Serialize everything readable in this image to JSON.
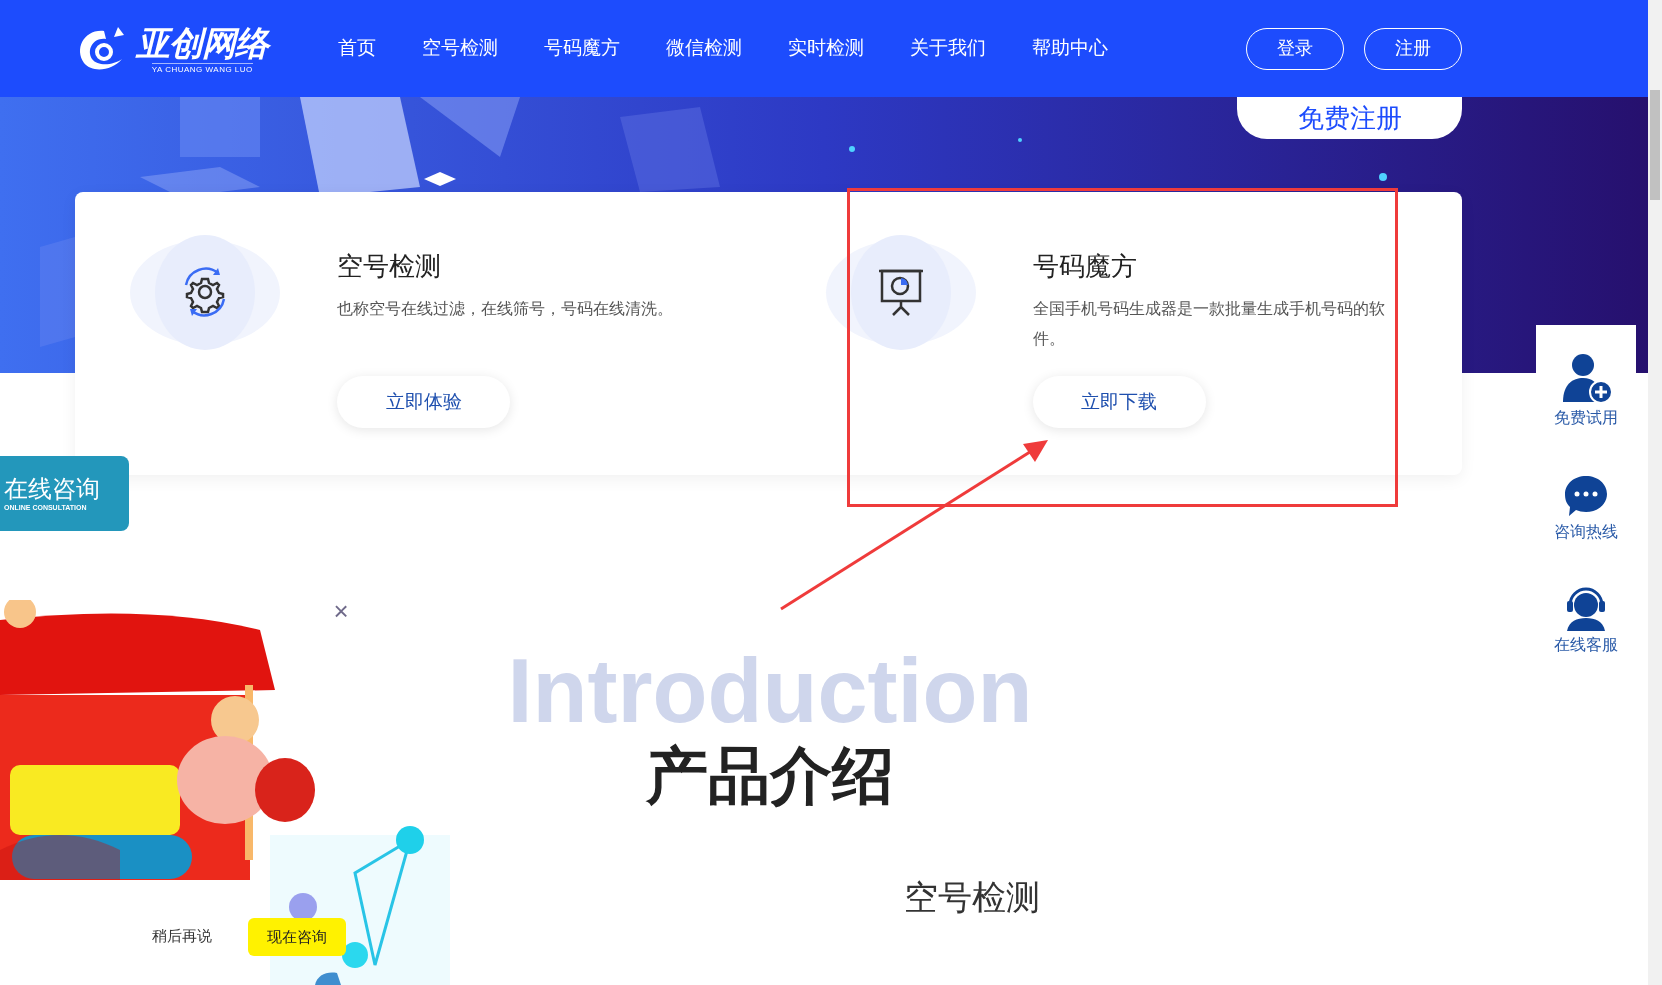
{
  "header": {
    "logo": {
      "name": "亚创网络",
      "tagline": "YA CHUANG WANG LUO"
    },
    "nav": [
      "首页",
      "空号检测",
      "号码魔方",
      "微信检测",
      "实时检测",
      "关于我们",
      "帮助中心"
    ],
    "buttons": [
      "登录",
      "注册"
    ]
  },
  "hero": {
    "kind": "picture",
    "button": "免费注册"
  },
  "products": [
    {
      "title": "空号检测",
      "description": "也称空号在线过滤，在线筛号，号码在线清洗。",
      "button": "立即体验",
      "highlighted": false
    },
    {
      "title": "号码魔方",
      "description": "全国手机号码生成器是一款批量生成手机号码的软件。",
      "button": "立即下载",
      "highlighted": true
    }
  ],
  "consult_tab": {
    "title": "在线咨询",
    "subtitle": "ONLINE CONSULTATION"
  },
  "side_tools": [
    "免费试用",
    "咨询热线",
    "在线客服"
  ],
  "section": {
    "background_title": "Introduction",
    "title": "产品介绍",
    "subtitle": "空号检测"
  },
  "promo": {
    "kind": "picture",
    "close": "×",
    "later": "稍后再说",
    "consult": "现在咨询"
  }
}
